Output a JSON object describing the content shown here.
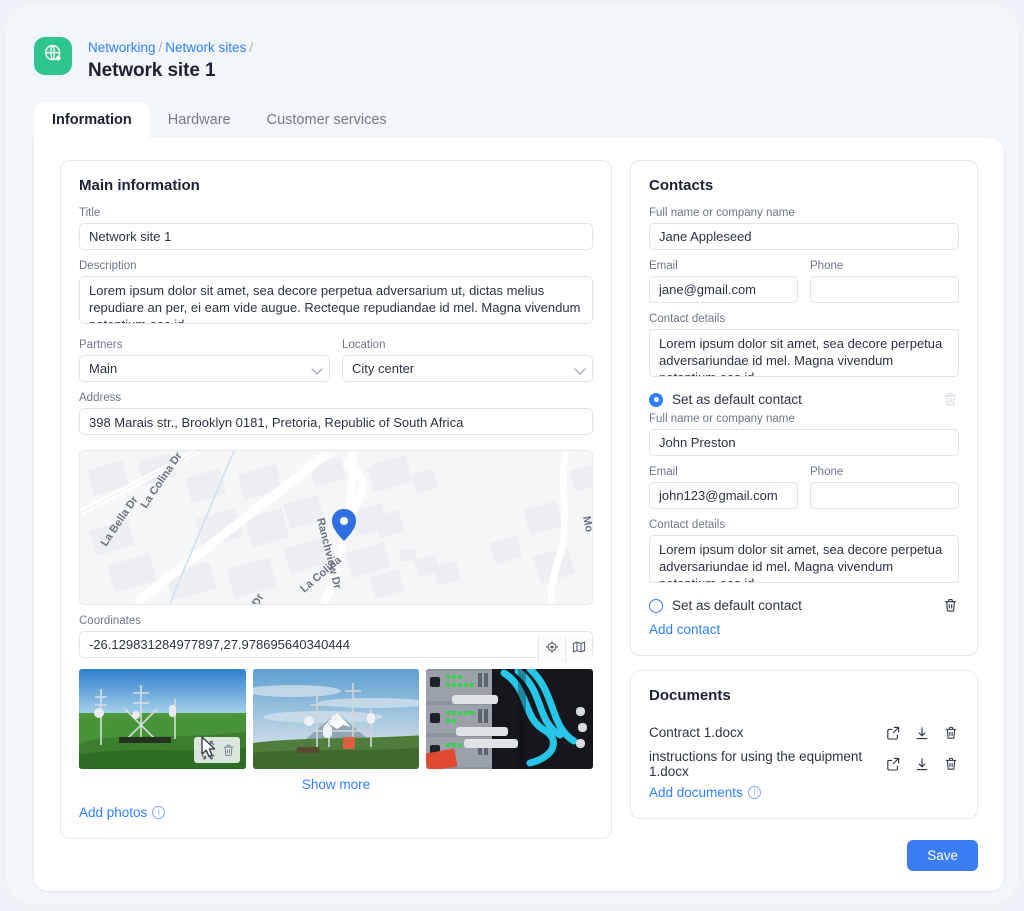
{
  "brand": {
    "logo_icon": "globe-network-icon",
    "logo_color": "#2ec48e",
    "accent": "#2f80ff",
    "save_color": "#3b7df5"
  },
  "breadcrumb": {
    "items": [
      "Networking",
      "Network sites"
    ],
    "separator": "/"
  },
  "header": {
    "title": "Network site 1"
  },
  "tabs": [
    {
      "label": "Information",
      "active": true
    },
    {
      "label": "Hardware",
      "active": false
    },
    {
      "label": "Customer services",
      "active": false
    }
  ],
  "main_information": {
    "panel_title": "Main information",
    "title": {
      "label": "Title",
      "value": "Network site 1"
    },
    "description": {
      "label": "Description",
      "value": "Lorem ipsum dolor sit amet, sea decore perpetua adversarium ut, dictas melius repudiare an per, ei eam vide augue. Recteque repudiandae id mel. Magna vivendum petentium eos id"
    },
    "partners": {
      "label": "Partners",
      "value": "Main"
    },
    "location": {
      "label": "Location",
      "value": "City center"
    },
    "address": {
      "label": "Address",
      "value": "398 Marais str., Brooklyn 0181, Pretoria, Republic of South Africa"
    },
    "map": {
      "street_labels": [
        "La Bella Dr",
        "La Colina Dr",
        "Ranchview Dr",
        "La Colina Dr",
        "Mo"
      ],
      "marker_color": "#2f6fe0"
    },
    "coordinates": {
      "label": "Coordinates",
      "value": "-26.129831284977897,27.978695640340444",
      "buttons": [
        {
          "icon": "target-crosshair-icon"
        },
        {
          "icon": "map-fold-icon"
        }
      ]
    },
    "photos": {
      "items": [
        {
          "alt": "telecom masts on green hilltop"
        },
        {
          "alt": "antenna towers with snow mountain"
        },
        {
          "alt": "network switch with fiber cables"
        }
      ],
      "overlay": {
        "expand_icon": "expand-fullscreen-icon",
        "delete_icon": "trash-icon"
      },
      "show_more": "Show more",
      "add_photos": "Add photos",
      "add_photos_info_icon": "info-icon"
    }
  },
  "contacts": {
    "panel_title": "Contacts",
    "labels": {
      "name": "Full name or company name",
      "email": "Email",
      "phone": "Phone",
      "details": "Contact details",
      "default": "Set as default contact"
    },
    "items": [
      {
        "name": "Jane Appleseed",
        "email": "jane@gmail.com",
        "phone": "",
        "details": "Lorem ipsum dolor sit amet, sea decore perpetua adversariundae id mel. Magna vivendum petentium eos id",
        "is_default": true,
        "delete_disabled": true
      },
      {
        "name": "John Preston",
        "email": "john123@gmail.com",
        "phone": "",
        "details": "Lorem ipsum dolor sit amet, sea decore perpetua adversariundae id mel. Magna vivendum petentium eos id",
        "is_default": false,
        "delete_disabled": false
      }
    ],
    "add_contact": "Add contact"
  },
  "documents": {
    "panel_title": "Documents",
    "items": [
      {
        "name": "Contract 1.docx"
      },
      {
        "name": "instructions for using the equipment 1.docx"
      }
    ],
    "row_icons": [
      "open-external-icon",
      "download-icon",
      "trash-icon"
    ],
    "add_documents": "Add documents",
    "add_documents_info_icon": "info-icon"
  },
  "footer": {
    "save_label": "Save"
  }
}
